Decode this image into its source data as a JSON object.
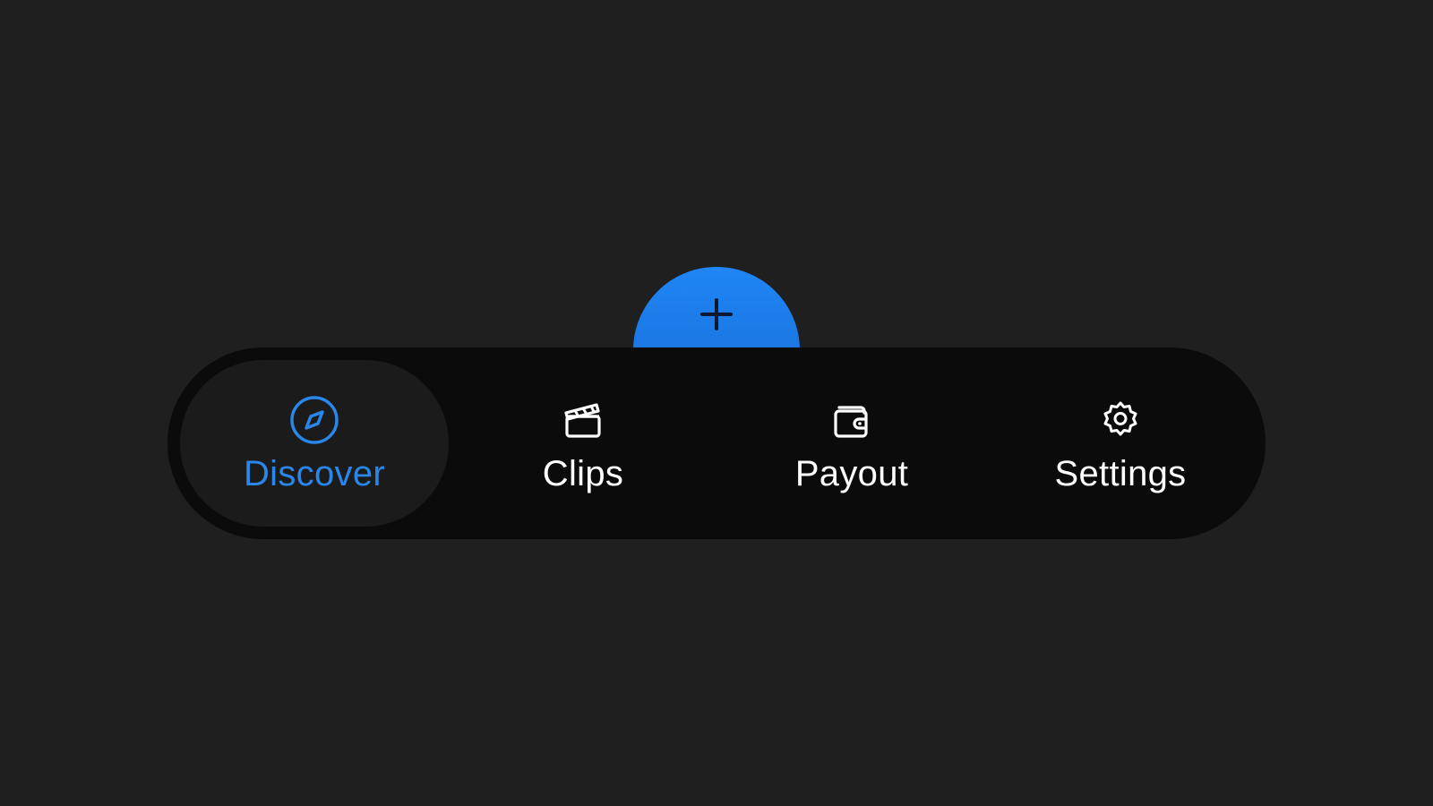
{
  "fab": {
    "label": "+",
    "icon": "plus-icon",
    "color": "#1a74df"
  },
  "navbar": {
    "active_index": 0,
    "active_color": "#2a86e8",
    "items": [
      {
        "label": "Discover",
        "icon": "compass-icon",
        "active": true
      },
      {
        "label": "Clips",
        "icon": "clapperboard-icon",
        "active": false
      },
      {
        "label": "Payout",
        "icon": "wallet-icon",
        "active": false
      },
      {
        "label": "Settings",
        "icon": "gear-icon",
        "active": false
      }
    ]
  }
}
